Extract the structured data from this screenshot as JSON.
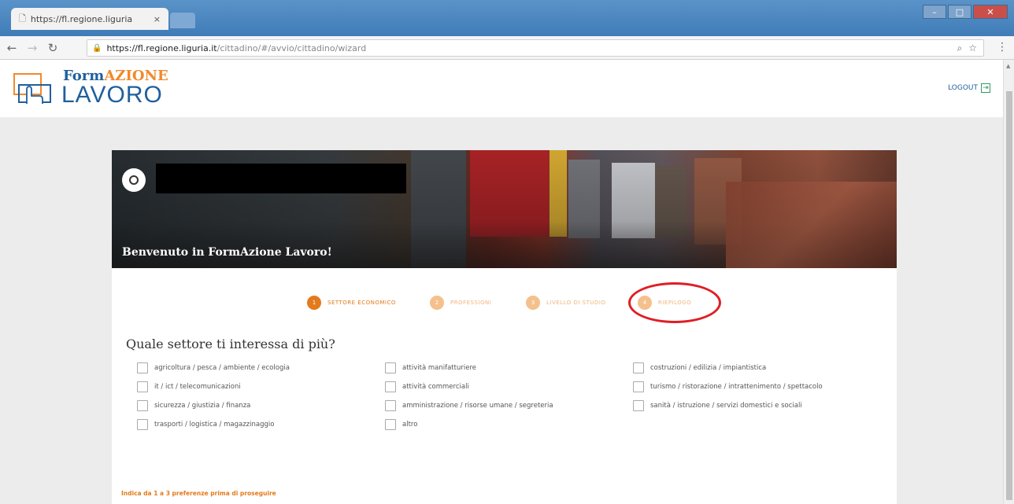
{
  "browser": {
    "tab_title": "https://fl.regione.liguria",
    "tab_close": "×",
    "url_host": "https://fl.regione.liguria.it",
    "url_path": "/cittadino/#/avvio/cittadino/wizard",
    "menu_glyph": "⋮"
  },
  "header": {
    "logo_form": "Form",
    "logo_azione": "AZIONE",
    "logo_lavoro": "LAVORO",
    "logout": "LOGOUT"
  },
  "hero": {
    "welcome": "Benvenuto in FormAzione Lavoro!"
  },
  "stepper": {
    "steps": [
      {
        "num": "1",
        "label": "SETTORE ECONOMICO",
        "state": "active"
      },
      {
        "num": "2",
        "label": "PROFESSIONI",
        "state": "pending"
      },
      {
        "num": "3",
        "label": "LIVELLO DI STUDIO",
        "state": "pending"
      },
      {
        "num": "4",
        "label": "RIEPILOGO",
        "state": "pending"
      }
    ]
  },
  "question": {
    "title": "Quale settore ti interessa di più?",
    "options": [
      "agricoltura / pesca / ambiente / ecologia",
      "attività manifatturiere",
      "costruzioni / edilizia / impiantistica",
      "it / ict / telecomunicazioni",
      "attività commerciali",
      "turismo / ristorazione / intrattenimento / spettacolo",
      "sicurezza / giustizia / finanza",
      "amministrazione / risorse umane / segreteria",
      "sanità / istruzione / servizi domestici e sociali",
      "trasporti / logistica / magazzinaggio",
      "altro"
    ],
    "hint": "Indica da 1 a 3 preferenze prima di proseguire"
  },
  "colors": {
    "accent": "#e37a1b",
    "brand": "#1f5f9e",
    "highlight": "#e01e25"
  }
}
